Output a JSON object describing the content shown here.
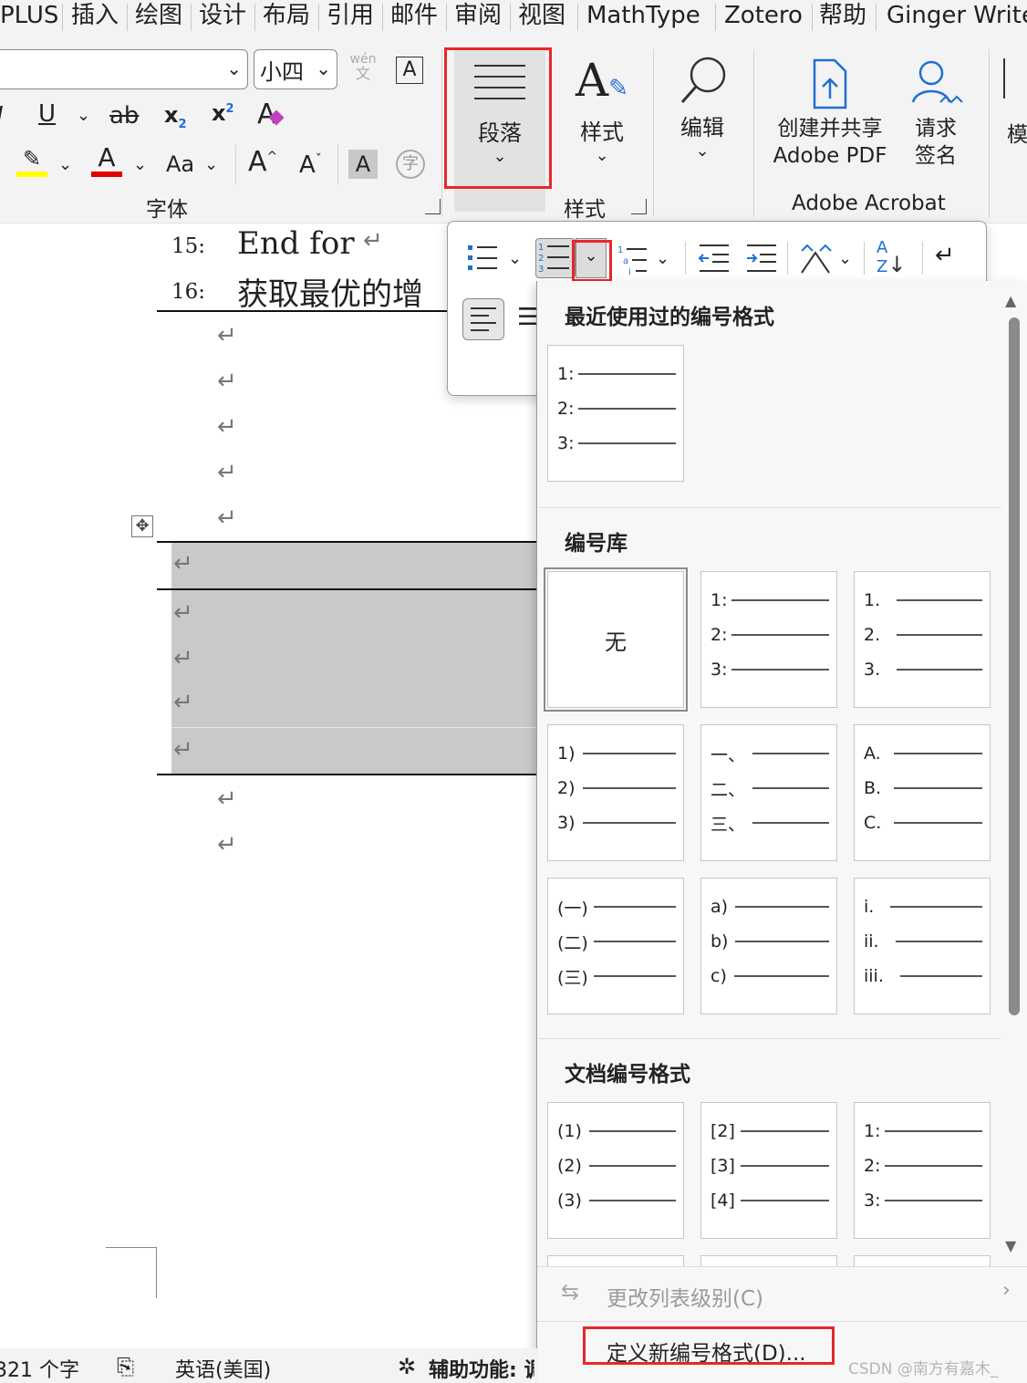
{
  "menu_tabs": [
    "PLUS",
    "插入",
    "绘图",
    "设计",
    "布局",
    "引用",
    "邮件",
    "审阅",
    "视图",
    "MathType",
    "Zotero",
    "帮助",
    "Ginger Write"
  ],
  "font_group": {
    "font_name_value": "",
    "font_size_value": "小四",
    "phonetic_top": "wén",
    "phonetic_bottom": "文",
    "char_border": "A",
    "underline": "U",
    "strike": "ab",
    "subscript": "x",
    "sub_mark": "2",
    "superscript": "x",
    "sup_mark": "2",
    "clear_format": "A",
    "font_color": "A",
    "change_case": "Aa",
    "grow": "A",
    "shrink": "A",
    "shading": "A",
    "enclose": "字",
    "label": "字体"
  },
  "paragraph_button": {
    "label": "段落"
  },
  "styles_button": {
    "label": "样式",
    "group_label": "样式"
  },
  "edit_button": {
    "label": "编辑"
  },
  "acrobat": {
    "create_share_line1": "创建并共享",
    "create_share_line2": "Adobe PDF",
    "request_sign_line1": "请求",
    "request_sign_line2": "签名",
    "group_label": "Adobe Acrobat"
  },
  "cut_off_label": "模",
  "document": {
    "lines": [
      {
        "num": "15:",
        "text": "End for"
      },
      {
        "num": "16:",
        "text": "获取最优的增"
      }
    ],
    "return_mark": "↵"
  },
  "numbering_menu": {
    "recent_title": "最近使用过的编号格式",
    "recent": [
      [
        "1:",
        "2:",
        "3:"
      ]
    ],
    "library_title": "编号库",
    "none_label": "无",
    "library": [
      [
        "1:",
        "2:",
        "3:"
      ],
      [
        "1.",
        "2.",
        "3."
      ],
      [
        "1)",
        "2)",
        "3)"
      ],
      [
        "一、",
        "二、",
        "三、"
      ],
      [
        "A.",
        "B.",
        "C."
      ],
      [
        "(一)",
        "(二)",
        "(三)"
      ],
      [
        "a)",
        "b)",
        "c)"
      ],
      [
        "i.",
        "ii.",
        "iii."
      ]
    ],
    "doc_title": "文档编号格式",
    "doc_formats": [
      [
        "(1)",
        "(2)",
        "(3)"
      ],
      [
        "[2]",
        "[3]",
        "[4]"
      ],
      [
        "1:",
        "2:",
        "3:"
      ]
    ],
    "change_level": "更改列表级别(C)",
    "define_new": "定义新编号格式(D)..."
  },
  "status_bar": {
    "word_count": "321 个字",
    "language": "英语(美国)",
    "accessibility": "辅助功能: 调"
  },
  "watermark": "CSDN @南方有嘉木_",
  "colors": {
    "highlight": "#ffff00",
    "font_color": "#e00000",
    "red_box": "#e8262a",
    "acrobat_blue": "#1f6fd0"
  }
}
